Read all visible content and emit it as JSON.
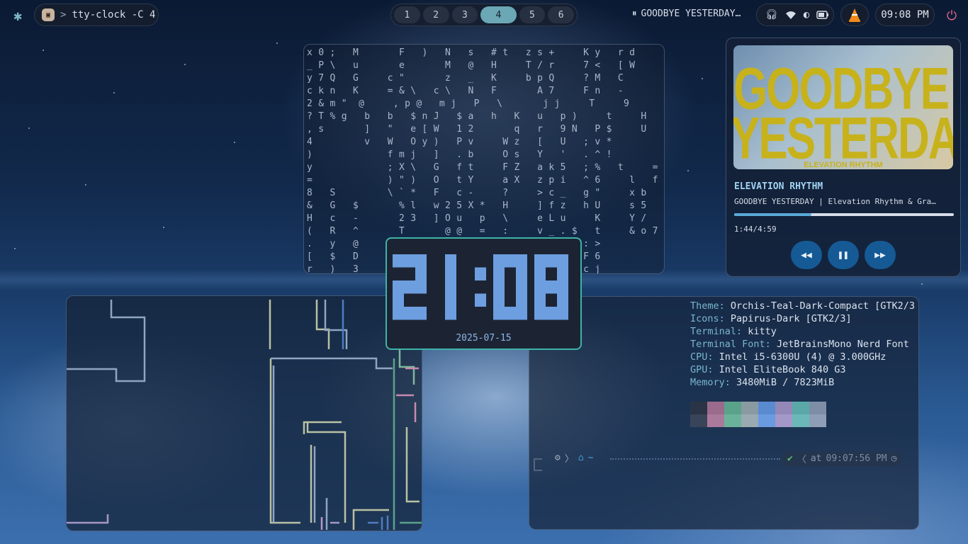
{
  "topbar": {
    "terminal_title": "tty-clock -C 4",
    "workspaces": [
      {
        "label": "1",
        "active": false
      },
      {
        "label": "2",
        "active": false
      },
      {
        "label": "3",
        "active": false
      },
      {
        "label": "4",
        "active": true
      },
      {
        "label": "5",
        "active": false
      },
      {
        "label": "6",
        "active": false
      }
    ],
    "now_playing": "GOODBYE YESTERDAY…",
    "clock": "09:08 PM",
    "icons": [
      "settings-icon",
      "headphones-icon",
      "wifi-icon",
      "brightness-icon",
      "battery-icon",
      "vlc-icon",
      "power-icon"
    ]
  },
  "matrix": {
    "lines": [
      "x 0 ;   M       F   )   N   s   # t   z s +     K y   r d",
      "_ P \\   u       e       M   @   H     T / r     7 <   [ W",
      "y 7 Q   G     c \"       z   _   K     b p Q     ? M   C",
      "c k n   K     = & \\   c \\   N   F       A 7     F n   -",
      "2 & m \"  @     , p @   m j   P   \\       j j     T     9",
      "? T % g   b   b   $ n J   $ a   h   K   u   p )     t     H",
      ", s       ]   \"   e [ W   1 2       q   r   9 N   P $     U",
      "4         v   W   O y )   P v     W z   [   U   ; v *",
      ")             f m j   ]   . b     O s   Y   '   . ^ !",
      "y             ; X \\   G   f t     F Z   a k 5   ; %   t     =",
      "=             ) \" )   O   t Y     a X   z p i   ^ 6     l   f",
      "8   S         \\ ` *   F   c -     ?     > c _   g \"     x b",
      "&   G   $       % l   w 2 5 X *   H     ] f z   h U     s 5",
      "H   c   -       2 3   ] O u   p   \\     e L u     K     Y /",
      "(   R   ^       T       @ @   =   :     v _ . $   t     & o 7",
      ".   y   @                               j ` Y G : >",
      "[   $   D                               S L w Z F 6",
      "r   )   3                               q W I b c j"
    ]
  },
  "clock_popup": {
    "time": "21:08",
    "date": "2025-07-15"
  },
  "music": {
    "cover_line1": "GOODBYE",
    "cover_line2": "YESTERDA",
    "cover_sub": "ELEVATION RHYTHM",
    "artist": "ELEVATION RHYTHM",
    "title": "GOODBYE YESTERDAY | Elevation Rhythm & Gra…",
    "position": "1:44/4:59",
    "progress_fraction": 0.35,
    "controls": [
      "rewind-icon",
      "pause-icon",
      "fast-forward-icon"
    ]
  },
  "fetch": {
    "rows": [
      {
        "key": "Theme:",
        "value": "Orchis-Teal-Dark-Compact [GTK2/3"
      },
      {
        "key": "Icons:",
        "value": "Papirus-Dark [GTK2/3]"
      },
      {
        "key": "Terminal:",
        "value": "kitty"
      },
      {
        "key": "Terminal Font:",
        "value": "JetBrainsMono Nerd Font"
      },
      {
        "key": "CPU:",
        "value": "Intel i5-6300U (4) @ 3.000GHz"
      },
      {
        "key": "GPU:",
        "value": "Intel EliteBook 840 G3"
      },
      {
        "key": "Memory:",
        "value": "3480MiB / 7823MiB"
      }
    ],
    "palette_top": [
      "#2a3446",
      "#9a6b8c",
      "#5aa38a",
      "#8a9aa2",
      "#5a8ad0",
      "#9488b8",
      "#5aa8a8",
      "#7d8ea6"
    ],
    "palette_bottom": [
      "#3a4458",
      "#a97a9c",
      "#6ab39a",
      "#9aaab2",
      "#6a9ae0",
      "#a498c8",
      "#6ab8b8",
      "#8d9eb6"
    ],
    "prompt": {
      "home": "~",
      "at_label": "at",
      "time": "09:07:56 PM"
    }
  },
  "colors": {
    "accent": "#6ba7b4",
    "clock_digits": "#6d9ee0",
    "clock_border": "#3fb3a8",
    "power": "#e06a8a"
  }
}
